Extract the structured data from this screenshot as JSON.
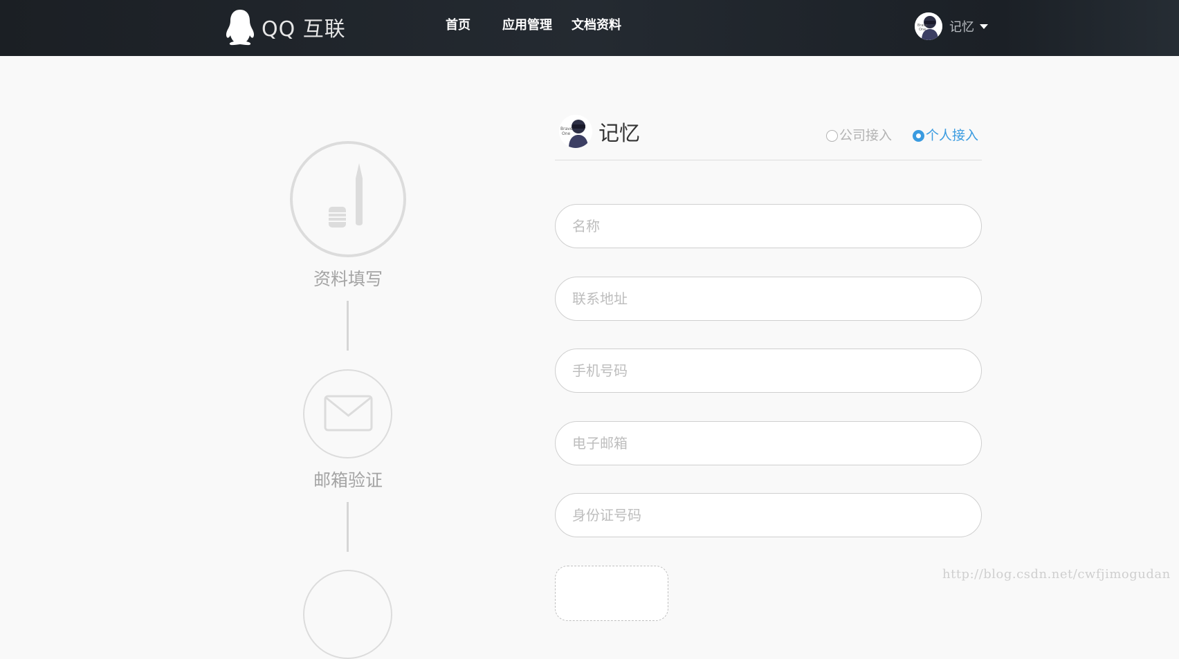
{
  "header": {
    "logo_text": "QQ 互联",
    "nav": [
      {
        "label": "首页"
      },
      {
        "label": "应用管理"
      },
      {
        "label": "文档资料"
      }
    ],
    "user": {
      "name": "记忆"
    }
  },
  "steps": [
    {
      "label": "资料填写",
      "icon": "pen-icon"
    },
    {
      "label": "邮箱验证",
      "icon": "envelope-icon"
    }
  ],
  "form": {
    "account_name": "记忆",
    "access_type": {
      "options": [
        "公司接入",
        "个人接入"
      ],
      "selected": "个人接入"
    },
    "fields": [
      {
        "placeholder": "名称",
        "value": ""
      },
      {
        "placeholder": "联系地址",
        "value": ""
      },
      {
        "placeholder": "手机号码",
        "value": ""
      },
      {
        "placeholder": "电子邮箱",
        "value": ""
      },
      {
        "placeholder": "身份证号码",
        "value": ""
      }
    ]
  },
  "watermark": "http://blog.csdn.net/cwfjimogudan",
  "colors": {
    "accent": "#3a9be0",
    "header_bg": "#1f242a",
    "page_bg": "#f9f9f9"
  }
}
